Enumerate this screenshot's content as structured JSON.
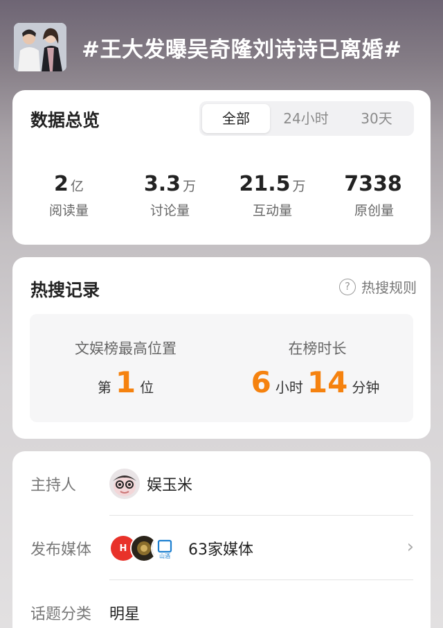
{
  "topic": {
    "title": "#王大发曝吴奇隆刘诗诗已离婚#",
    "thumbnail_icon": "couple-photo-thumbnail"
  },
  "overview": {
    "title": "数据总览",
    "tabs": [
      {
        "label": "全部",
        "active": true
      },
      {
        "label": "24小时",
        "active": false
      },
      {
        "label": "30天",
        "active": false
      }
    ],
    "stats": [
      {
        "value": "2",
        "unit": "亿",
        "label": "阅读量"
      },
      {
        "value": "3.3",
        "unit": "万",
        "label": "讨论量"
      },
      {
        "value": "21.5",
        "unit": "万",
        "label": "互动量"
      },
      {
        "value": "7338",
        "unit": "",
        "label": "原创量"
      }
    ]
  },
  "hot_search": {
    "title": "热搜记录",
    "rules_label": "热搜规则",
    "rules_icon": "question-circle-icon",
    "highest_position": {
      "label": "文娱榜最高位置",
      "prefix": "第",
      "value": "1",
      "suffix": "位"
    },
    "duration": {
      "label": "在榜时长",
      "hours": "6",
      "hours_unit": "小时",
      "minutes": "14",
      "minutes_unit": "分钟"
    }
  },
  "info": {
    "host": {
      "label": "主持人",
      "name": "娱玉米"
    },
    "media": {
      "label": "发布媒体",
      "value": "63家媒体",
      "logo_text": "山酒"
    },
    "category": {
      "label": "话题分类",
      "value": "明星"
    }
  },
  "colors": {
    "accent_orange": "#f5820f",
    "card_bg": "#ffffff",
    "text_primary": "#222222",
    "text_secondary": "#777777"
  }
}
